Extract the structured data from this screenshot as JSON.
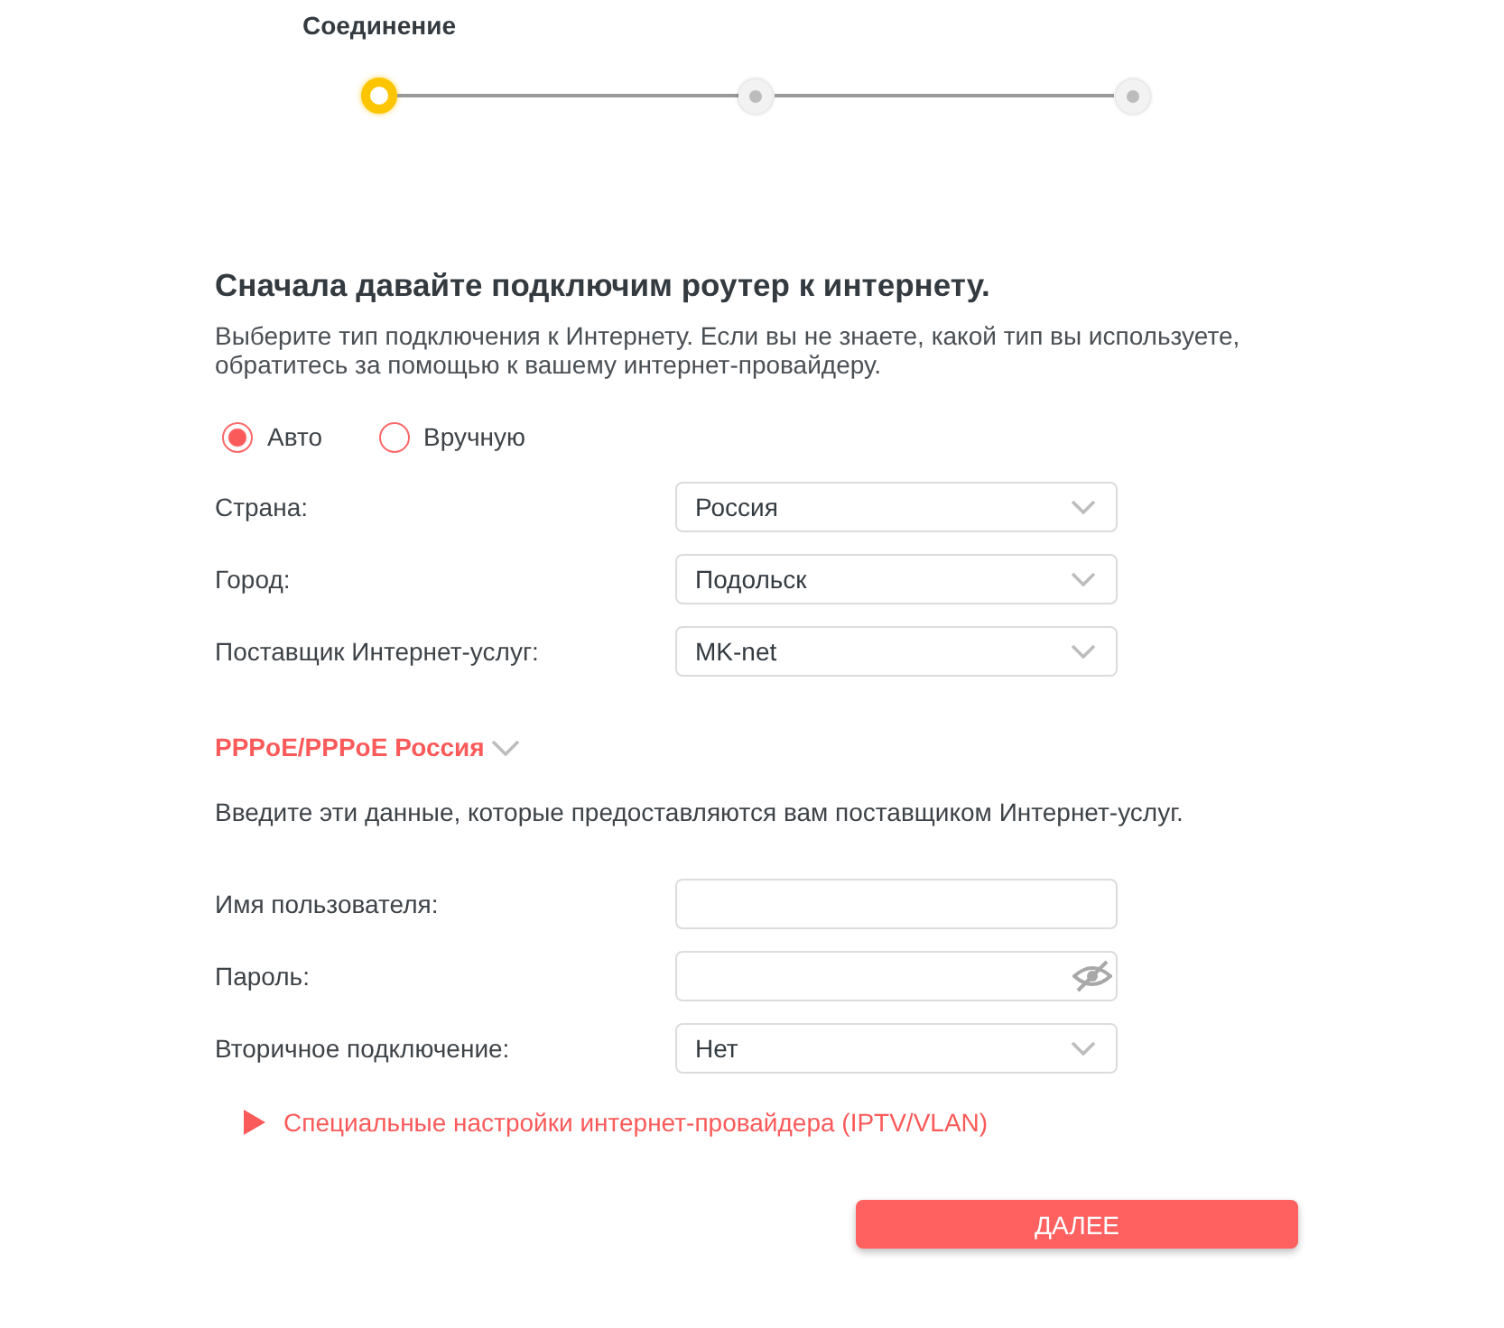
{
  "stepper": {
    "steps": [
      {
        "label": "Соединение",
        "selected": true
      },
      {
        "selected": false
      },
      {
        "selected": false
      }
    ]
  },
  "heading": "Сначала давайте подключим роутер к интернету.",
  "description": "Выберите тип подключения к Интернету. Если вы не знаете, какой тип вы используете, обратитесь за помощью к вашему интернет-провайдеру.",
  "connection_mode": [
    {
      "label": "Авто",
      "selected": true
    },
    {
      "label": "Вручную",
      "selected": false
    }
  ],
  "location_fields": [
    {
      "label": "Страна:",
      "kind": "select",
      "value": "Россия"
    },
    {
      "label": "Город:",
      "kind": "select",
      "value": "Подольск"
    },
    {
      "label": "Поставщик Интернет-услуг:",
      "kind": "select",
      "value": "MK-net"
    }
  ],
  "connection_type": {
    "label": "PPPoE/PPPoE Россия"
  },
  "credentials_hint": "Введите эти данные, которые предоставляются вам поставщиком Интернет-услуг.",
  "credential_fields": [
    {
      "label": "Имя пользователя:",
      "kind": "text"
    },
    {
      "label": "Пароль:",
      "kind": "password"
    },
    {
      "label": "Вторичное подключение:",
      "kind": "select",
      "value": "Нет"
    }
  ],
  "isp_settings": {
    "label": "Специальные настройки интернет-провайдера (IPTV/VLAN)",
    "expanded": false
  },
  "next_button": "ДАЛЕЕ"
}
